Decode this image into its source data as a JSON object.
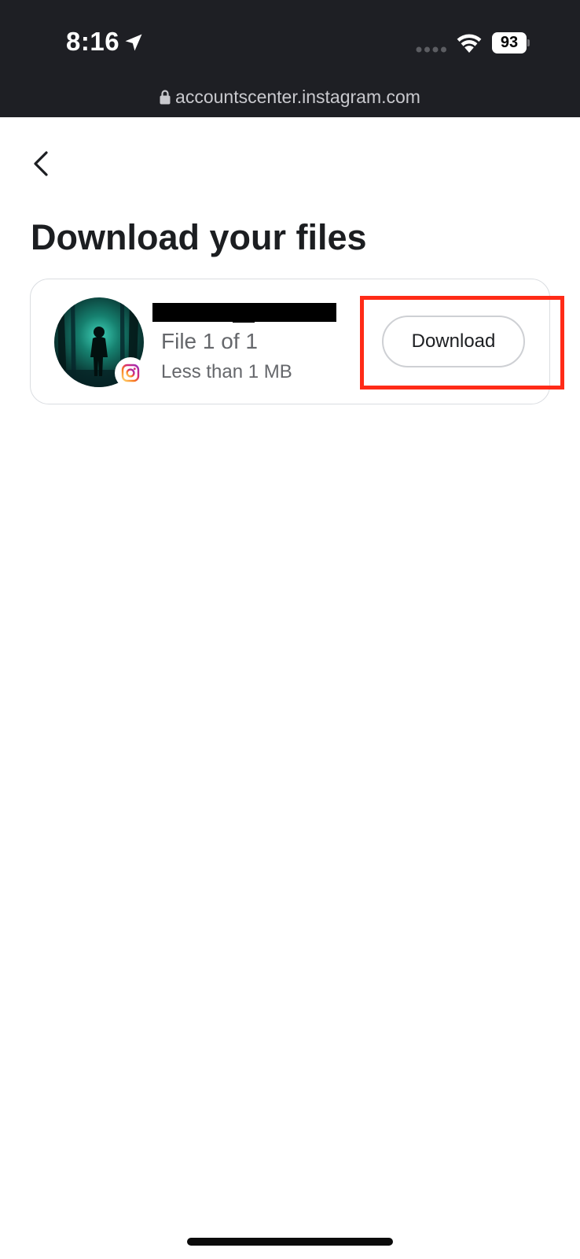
{
  "status_bar": {
    "time": "8:16",
    "battery_level": "93",
    "icons": [
      "location-arrow-icon",
      "cellular-signal-icon",
      "wifi-icon",
      "battery-icon"
    ]
  },
  "browser": {
    "url": "accountscenter.instagram.com",
    "lock_icon": "lock-icon"
  },
  "page": {
    "back_icon": "chevron-left-icon",
    "title": "Download your files"
  },
  "file_card": {
    "file_count": "File 1 of 1",
    "file_size": "Less than 1 MB",
    "download_label": "Download",
    "badge_icon": "instagram-icon",
    "highlight_color": "#ff2b17"
  }
}
